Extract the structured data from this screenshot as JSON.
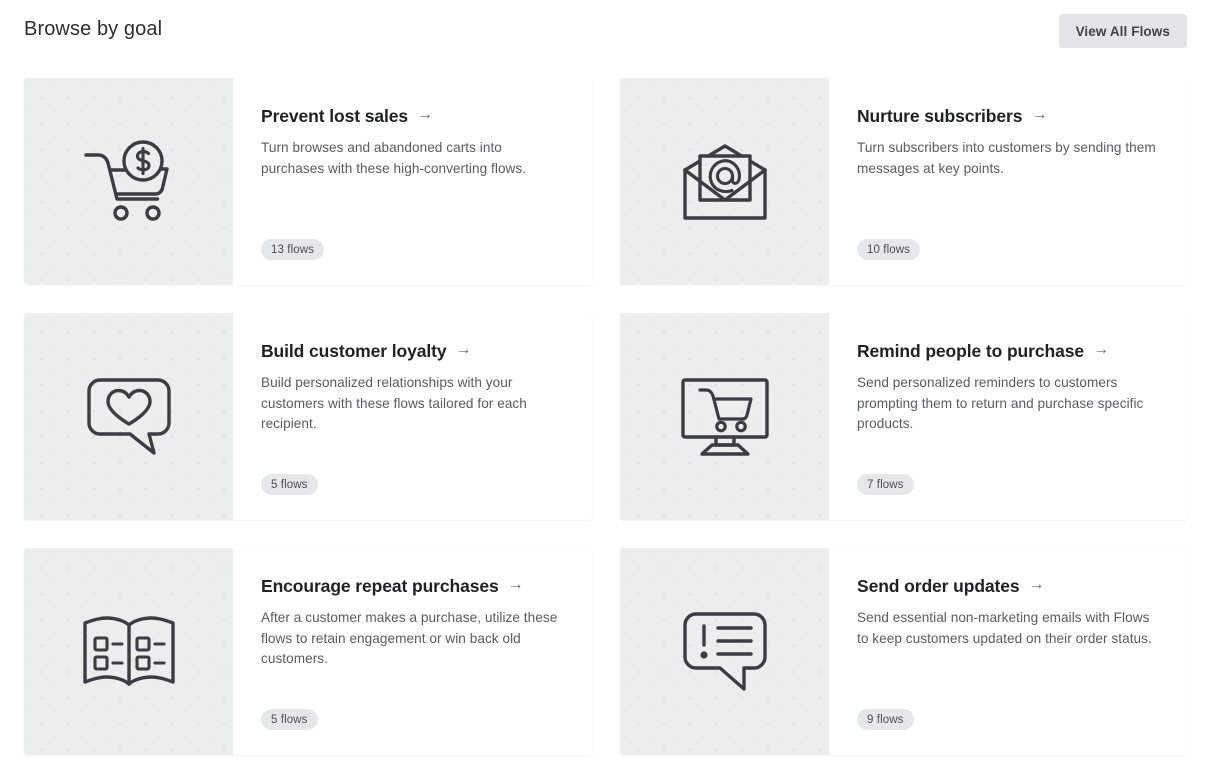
{
  "header": {
    "title": "Browse by goal",
    "view_all_label": "View All Flows"
  },
  "colors": {
    "panel_bg": "#eceded",
    "card_bg": "#ffffff",
    "badge_bg": "#e6e7ea",
    "button_bg": "#e3e5e8",
    "title_text": "#1f2126",
    "body_text": "#585c63",
    "icon_stroke": "#3a3d42"
  },
  "cards": [
    {
      "icon": "shopping-cart-dollar-icon",
      "title": "Prevent lost sales",
      "arrow": "→",
      "description": "Turn browses and abandoned carts into purchases with these high-converting flows.",
      "badge": "13 flows"
    },
    {
      "icon": "open-envelope-at-icon",
      "title": "Nurture subscribers",
      "arrow": "→",
      "description": "Turn subscribers into customers by sending them messages at key points.",
      "badge": "10 flows"
    },
    {
      "icon": "speech-bubble-heart-icon",
      "title": "Build customer loyalty",
      "arrow": "→",
      "description": "Build personalized relationships with your customers with these flows tailored for each recipient.",
      "badge": "5 flows"
    },
    {
      "icon": "monitor-cart-icon",
      "title": "Remind people to purchase",
      "arrow": "→",
      "description": "Send personalized reminders to customers prompting them to return and purchase specific products.",
      "badge": "7 flows"
    },
    {
      "icon": "open-book-catalog-icon",
      "title": "Encourage repeat purchases",
      "arrow": "→",
      "description": "After a customer makes a purchase, utilize these flows to retain engagement or win back old customers.",
      "badge": "5 flows"
    },
    {
      "icon": "speech-bubble-alert-icon",
      "title": "Send order updates",
      "arrow": "→",
      "description": "Send essential non-marketing emails with Flows to keep customers updated on their order status.",
      "badge": "9 flows"
    }
  ]
}
